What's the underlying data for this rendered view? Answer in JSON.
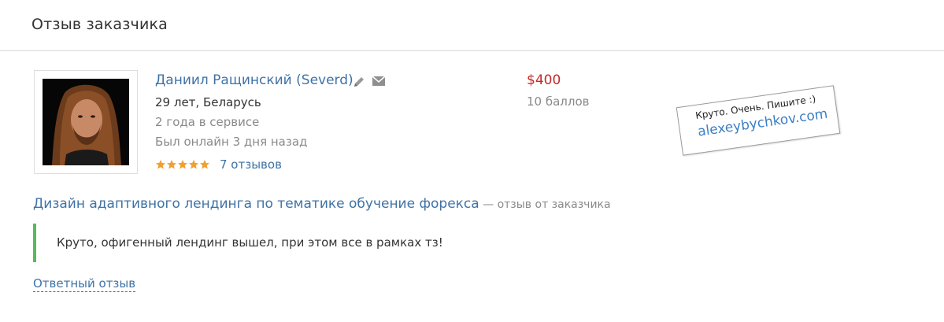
{
  "header": {
    "title": "Отзыв заказчика"
  },
  "user": {
    "name": "Даниил Ращинский (Severd)",
    "age_country": "29 лет, Беларусь",
    "service_time": "2 года в сервисе",
    "last_online": "Был онлайн 3 дня назад",
    "rating_stars": 5,
    "rating_max": 5,
    "reviews_link": "7 отзывов"
  },
  "deal": {
    "price": "$400",
    "points": "10 баллов"
  },
  "watermark": {
    "line1": "Круто. Очень. Пишите :)",
    "line2": "alexeybychkov.com"
  },
  "review": {
    "project_title": "Дизайн адаптивного лендинга по тематике обучение форекса",
    "project_suffix": " — отзыв от заказчика",
    "text": "Круто, офигенный лендинг вышел, при этом все в рамках тз!"
  },
  "reply": {
    "label": "Ответный отзыв"
  },
  "icons": {
    "edit": "pencil-icon",
    "message": "envelope-icon",
    "rating": "star-icon"
  },
  "colors": {
    "link": "#3f72a6",
    "price": "#c62828",
    "muted": "#8a8a8a",
    "star": "#f0a030",
    "quote_border": "#5cb85c"
  }
}
